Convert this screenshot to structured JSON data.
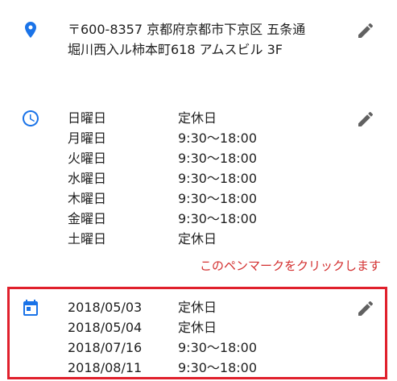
{
  "address": {
    "icon": "location-pin-icon",
    "line1": "〒600-8357 京都府京都市下京区 五条通",
    "line2": "堀川西入ル柿本町618 アムスビル 3F"
  },
  "hours": {
    "icon": "clock-icon",
    "rows": [
      {
        "day": "日曜日",
        "value": "定休日"
      },
      {
        "day": "月曜日",
        "value": "9:30～18:00"
      },
      {
        "day": "火曜日",
        "value": "9:30～18:00"
      },
      {
        "day": "水曜日",
        "value": "9:30～18:00"
      },
      {
        "day": "木曜日",
        "value": "9:30～18:00"
      },
      {
        "day": "金曜日",
        "value": "9:30～18:00"
      },
      {
        "day": "土曜日",
        "value": "定休日"
      }
    ]
  },
  "annotation": {
    "note": "このペンマークをクリックします",
    "color": "#d32f2f",
    "highlight_color": "#e0202c"
  },
  "special_hours": {
    "icon": "calendar-icon",
    "rows": [
      {
        "date": "2018/05/03",
        "value": "定休日"
      },
      {
        "date": "2018/05/04",
        "value": "定休日"
      },
      {
        "date": "2018/07/16",
        "value": "9:30～18:00"
      },
      {
        "date": "2018/08/11",
        "value": "9:30～18:00"
      }
    ]
  },
  "edit_icon": "pencil-edit-icon",
  "colors": {
    "accent": "#1a73e8",
    "edit_icon": "#616161"
  }
}
